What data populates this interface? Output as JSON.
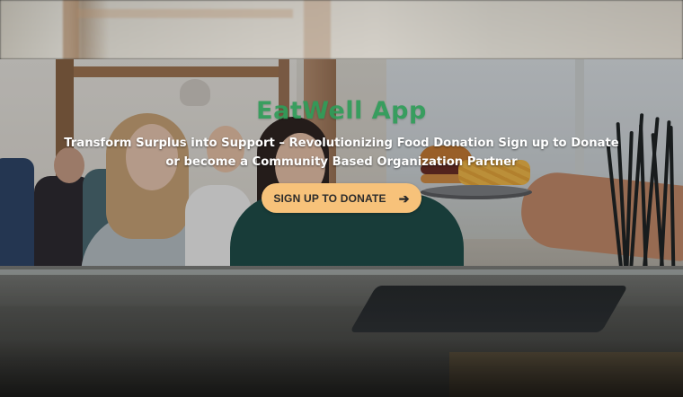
{
  "hero": {
    "title": "EatWell App",
    "subtitle": "Transform Surplus into Support – Revolutionizing Food Donation Sign up to Donate or become a Community Based Organization Partner",
    "cta_label": "SIGN UP TO DONATE",
    "cta_icon": "arrow-right-icon"
  },
  "colors": {
    "title_green": "#2f9d59",
    "cta_background": "#f7c27a",
    "text_white": "#ffffff"
  }
}
